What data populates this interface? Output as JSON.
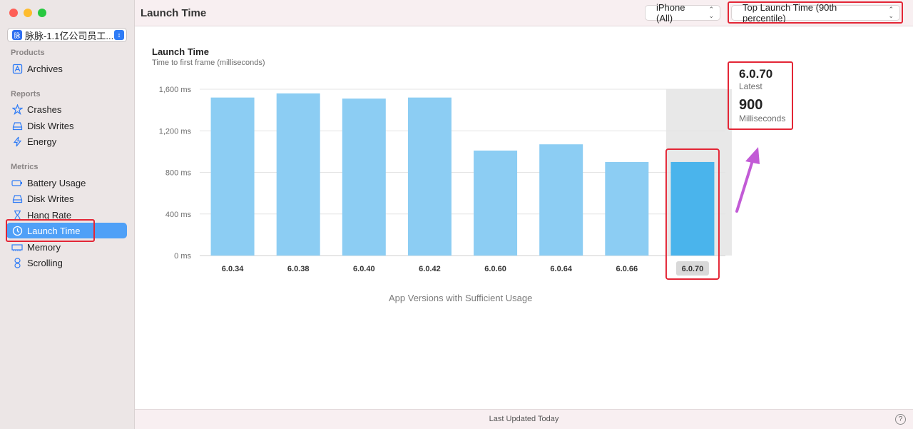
{
  "app": {
    "name": "脉脉-1.1亿公司员工...",
    "icon_text": "脉"
  },
  "sidebar": {
    "sections": [
      {
        "title": "Products",
        "items": [
          {
            "label": "Archives",
            "icon": "archive-icon"
          }
        ]
      },
      {
        "title": "Reports",
        "items": [
          {
            "label": "Crashes",
            "icon": "crash-icon"
          },
          {
            "label": "Disk Writes",
            "icon": "disk-icon"
          },
          {
            "label": "Energy",
            "icon": "bolt-icon"
          }
        ]
      },
      {
        "title": "Metrics",
        "items": [
          {
            "label": "Battery Usage",
            "icon": "battery-icon"
          },
          {
            "label": "Disk Writes",
            "icon": "disk-icon"
          },
          {
            "label": "Hang Rate",
            "icon": "hourglass-icon"
          },
          {
            "label": "Launch Time",
            "icon": "clock-icon",
            "active": true
          },
          {
            "label": "Memory",
            "icon": "memory-icon"
          },
          {
            "label": "Scrolling",
            "icon": "scroll-icon"
          }
        ]
      }
    ]
  },
  "toolbar": {
    "title": "Launch Time",
    "device_select": "iPhone (All)",
    "metric_select": "Top Launch Time (90th percentile)"
  },
  "chart": {
    "title": "Launch Time",
    "subtitle": "Time to first frame (milliseconds)",
    "x_title": "App Versions with Sufficient Usage"
  },
  "summary": {
    "version": "6.0.70",
    "version_label": "Latest",
    "value": "900",
    "value_label": "Milliseconds"
  },
  "status": {
    "updated": "Last Updated Today",
    "help": "?"
  },
  "colors": {
    "bar": "#8ccdf3",
    "bar_selected": "#4ab4ec",
    "selection_bg": "#e8e8e8",
    "annotation_red": "#e32636",
    "arrow": "#c25bd6"
  },
  "chart_data": {
    "type": "bar",
    "title": "Launch Time",
    "subtitle": "Time to first frame (milliseconds)",
    "xlabel": "App Versions with Sufficient Usage",
    "ylabel": "",
    "categories": [
      "6.0.34",
      "6.0.38",
      "6.0.40",
      "6.0.42",
      "6.0.60",
      "6.0.64",
      "6.0.66",
      "6.0.70"
    ],
    "values": [
      1520,
      1560,
      1510,
      1520,
      1010,
      1070,
      900,
      900
    ],
    "yticks": [
      "0 ms",
      "400 ms",
      "800 ms",
      "1,200 ms",
      "1,600 ms"
    ],
    "ytick_values": [
      0,
      400,
      800,
      1200,
      1600
    ],
    "ylim": [
      0,
      1600
    ],
    "selected": "6.0.70",
    "grid": true
  }
}
